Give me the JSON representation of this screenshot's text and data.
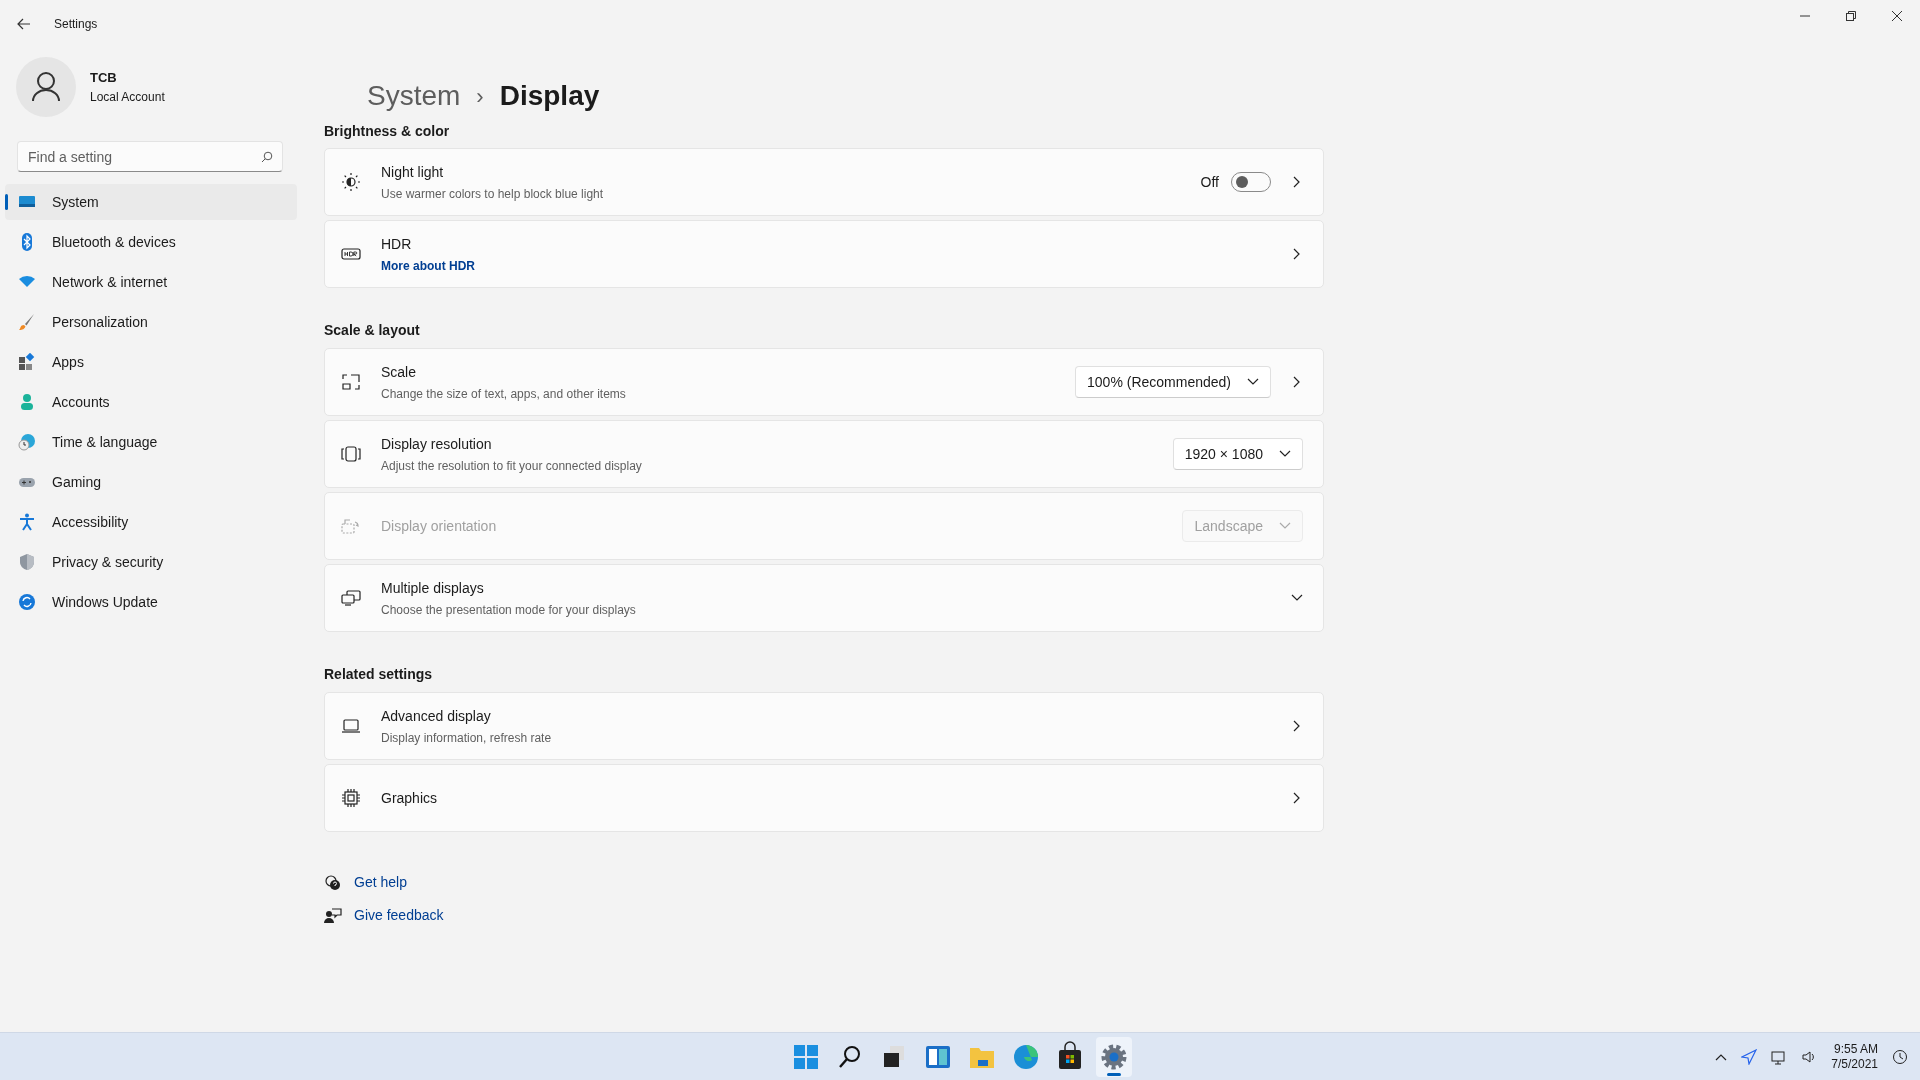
{
  "window": {
    "title": "Settings"
  },
  "account": {
    "name": "TCB",
    "type": "Local Account"
  },
  "search": {
    "placeholder": "Find a setting"
  },
  "nav": [
    {
      "label": "System",
      "selected": true
    },
    {
      "label": "Bluetooth & devices",
      "selected": false
    },
    {
      "label": "Network & internet",
      "selected": false
    },
    {
      "label": "Personalization",
      "selected": false
    },
    {
      "label": "Apps",
      "selected": false
    },
    {
      "label": "Accounts",
      "selected": false
    },
    {
      "label": "Time & language",
      "selected": false
    },
    {
      "label": "Gaming",
      "selected": false
    },
    {
      "label": "Accessibility",
      "selected": false
    },
    {
      "label": "Privacy & security",
      "selected": false
    },
    {
      "label": "Windows Update",
      "selected": false
    }
  ],
  "breadcrumb": {
    "parent": "System",
    "separator": "›",
    "current": "Display"
  },
  "sections": [
    {
      "heading": "Brightness & color",
      "cards": [
        {
          "title": "Night light",
          "subtitle": "Use warmer colors to help block blue light",
          "control": {
            "kind": "toggle",
            "label": "Off",
            "on": false
          },
          "trailing": {
            "kind": "chevron"
          }
        },
        {
          "title": "HDR",
          "link": "More about HDR",
          "trailing": {
            "kind": "chevron"
          }
        }
      ]
    },
    {
      "heading": "Scale & layout",
      "cards": [
        {
          "title": "Scale",
          "subtitle": "Change the size of text, apps, and other items",
          "control": {
            "kind": "dropdown",
            "value": "100% (Recommended)"
          },
          "trailing": {
            "kind": "chevron"
          }
        },
        {
          "title": "Display resolution",
          "subtitle": "Adjust the resolution to fit your connected display",
          "control": {
            "kind": "dropdown",
            "value": "1920 × 1080"
          }
        },
        {
          "title": "Display orientation",
          "disabled": true,
          "control": {
            "kind": "dropdown",
            "value": "Landscape"
          }
        },
        {
          "title": "Multiple displays",
          "subtitle": "Choose the presentation mode for your displays",
          "trailing": {
            "kind": "expand"
          }
        }
      ]
    },
    {
      "heading": "Related settings",
      "cards": [
        {
          "title": "Advanced display",
          "subtitle": "Display information, refresh rate",
          "trailing": {
            "kind": "chevron"
          }
        },
        {
          "title": "Graphics",
          "trailing": {
            "kind": "chevron"
          }
        }
      ]
    }
  ],
  "help_links": [
    "Get help",
    "Give feedback"
  ],
  "taskbar_apps": [
    {
      "selected": false
    },
    {
      "selected": false
    },
    {
      "selected": false
    },
    {
      "selected": false
    },
    {
      "selected": false
    },
    {
      "selected": false
    },
    {
      "selected": false
    },
    {
      "selected": true
    }
  ],
  "clock": {
    "time": "9:55 AM",
    "date": "7/5/2021"
  }
}
